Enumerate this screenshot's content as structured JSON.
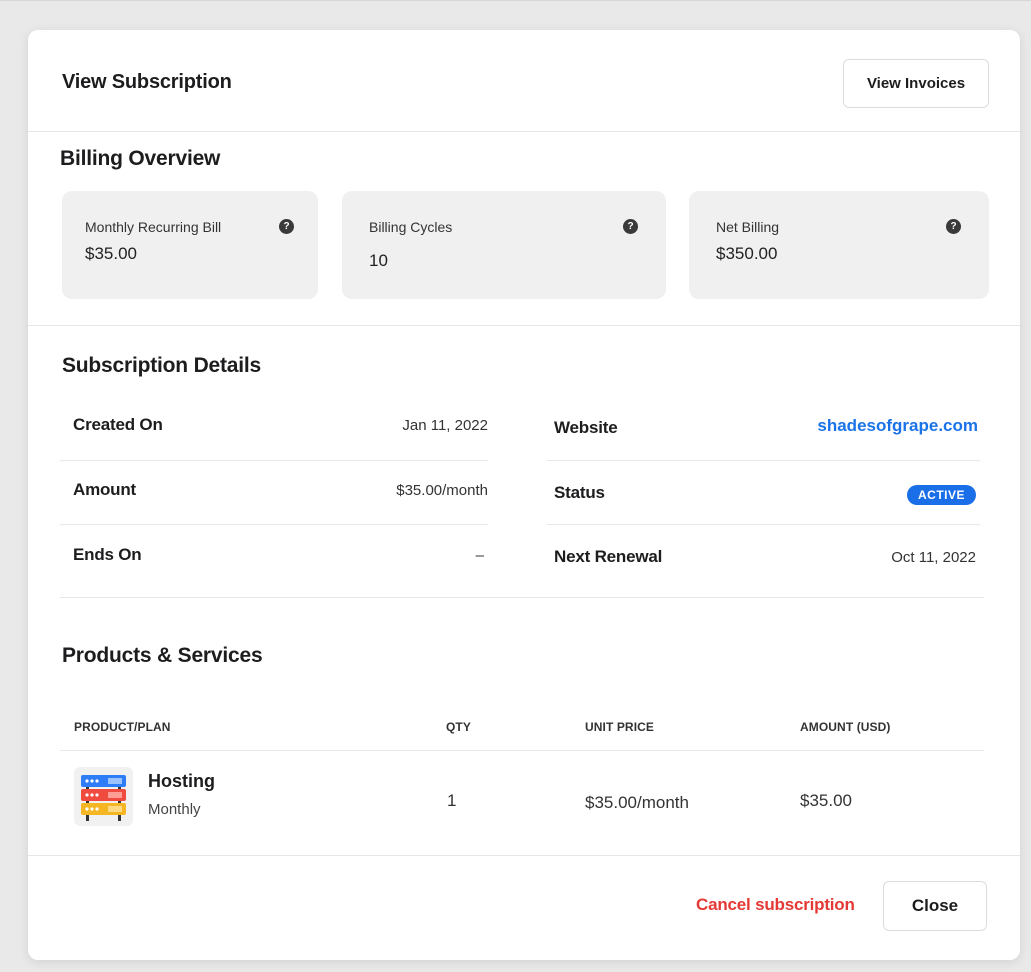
{
  "modal": {
    "title": "View Subscription",
    "view_invoices_label": "View Invoices"
  },
  "billing": {
    "title": "Billing Overview",
    "cards": [
      {
        "label": "Monthly Recurring Bill",
        "value": "$35.00",
        "help_icon": "question-circle-icon"
      },
      {
        "label": "Billing Cycles",
        "value": "10",
        "help_icon": "question-circle-icon"
      },
      {
        "label": "Net Billing",
        "value": "$350.00",
        "help_icon": "question-circle-icon"
      }
    ],
    "help_glyph": "?"
  },
  "details": {
    "title": "Subscription Details",
    "left": [
      {
        "label": "Created On",
        "value": "Jan 11, 2022"
      },
      {
        "label": "Amount",
        "value": "$35.00/month"
      },
      {
        "label": "Ends On",
        "value": "–"
      }
    ],
    "right": [
      {
        "label": "Website",
        "value": "shadesofgrape.com"
      },
      {
        "label": "Status",
        "value": "ACTIVE"
      },
      {
        "label": "Next Renewal",
        "value": "Oct 11, 2022"
      }
    ]
  },
  "products": {
    "title": "Products & Services",
    "columns": [
      "PRODUCT/PLAN",
      "QTY",
      "UNIT PRICE",
      "AMOUNT (USD)"
    ],
    "rows": [
      {
        "name": "Hosting",
        "plan": "Monthly",
        "qty": "1",
        "unit_price": "$35.00/month",
        "amount": "$35.00",
        "icon": "server-stack-icon"
      }
    ]
  },
  "footer": {
    "cancel_label": "Cancel subscription",
    "close_label": "Close"
  },
  "colors": {
    "accent_blue": "#1a73e8",
    "badge_blue": "#1a6fe8",
    "danger_red": "#e53935",
    "card_bg": "#f0f0f0"
  }
}
